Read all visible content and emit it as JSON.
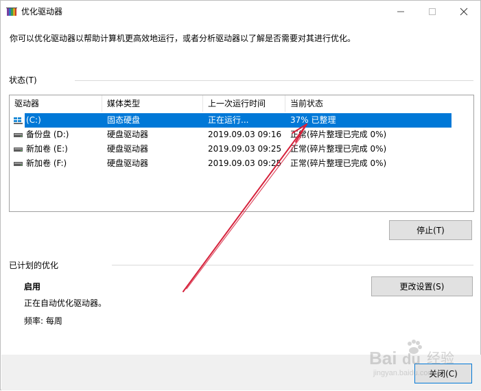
{
  "window": {
    "title": "优化驱动器",
    "controls": {
      "minimize": "—",
      "maximize": "☐",
      "close": "✕"
    }
  },
  "intro_text": "你可以优化驱动器以帮助计算机更高效地运行，或者分析驱动器以了解是否需要对其进行优化。",
  "status_section": {
    "label": "状态(T)",
    "columns": [
      "驱动器",
      "媒体类型",
      "上一次运行时间",
      "当前状态"
    ],
    "rows": [
      {
        "drive": "(C:)",
        "media": "固态硬盘",
        "last_run": "正在运行...",
        "status": "37% 已整理",
        "selected": true,
        "icon": "windows-drive-icon"
      },
      {
        "drive": "备份盘 (D:)",
        "media": "硬盘驱动器",
        "last_run": "2019.09.03 09:16",
        "status": "正常(碎片整理已完成 0%)",
        "selected": false,
        "icon": "hard-drive-icon"
      },
      {
        "drive": "新加卷 (E:)",
        "media": "硬盘驱动器",
        "last_run": "2019.09.03 09:25",
        "status": "正常(碎片整理已完成 0%)",
        "selected": false,
        "icon": "hard-drive-icon"
      },
      {
        "drive": "新加卷 (F:)",
        "media": "硬盘驱动器",
        "last_run": "2019.09.03 09:25",
        "status": "正常(碎片整理已完成 0%)",
        "selected": false,
        "icon": "hard-drive-icon"
      }
    ],
    "stop_button": "停止(T)"
  },
  "scheduled_section": {
    "label": "已计划的优化",
    "state": "启用",
    "description": "正在自动优化驱动器。",
    "frequency": "频率: 每周",
    "change_settings_button": "更改设置(S)"
  },
  "footer": {
    "close_button": "关闭(C)"
  },
  "watermark": {
    "brand": "Bai",
    "brand_suffix": "du",
    "cn": "经验",
    "url": "jingyan.baidu.com"
  },
  "colors": {
    "selection": "#0078d7",
    "annotation_arrow": "#d6213b",
    "footer_bg": "#f0f0f0",
    "button_bg": "#e1e1e1"
  }
}
